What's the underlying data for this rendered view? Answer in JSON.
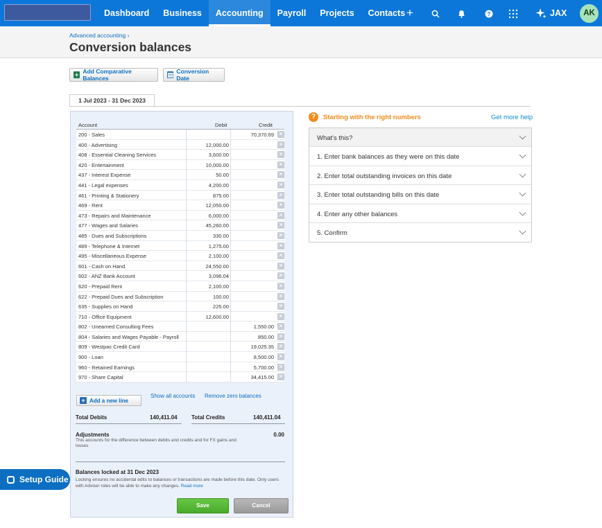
{
  "nav": {
    "items": [
      "Dashboard",
      "Business",
      "Accounting",
      "Payroll",
      "Projects",
      "Contacts"
    ],
    "active": "Accounting",
    "icons": [
      "plus-icon",
      "search-icon",
      "bell-icon",
      "help-icon",
      "apps-grid-icon"
    ],
    "jax_label": "JAX",
    "avatar_initials": "AK"
  },
  "header": {
    "breadcrumb": "Advanced accounting ›",
    "title": "Conversion balances"
  },
  "toolbar": {
    "add_comparative": "Add Comparative Balances",
    "conversion_date": "Conversion Date"
  },
  "period_tab": "1 Jul 2023 - 31 Dec 2023",
  "grid": {
    "headers": {
      "account": "Account",
      "debit": "Debit",
      "credit": "Credit"
    },
    "rows": [
      {
        "account": "200 - Sales",
        "debit": "",
        "credit": "70,370.69"
      },
      {
        "account": "400 - Advertising",
        "debit": "12,000.00",
        "credit": ""
      },
      {
        "account": "408 - Essential Cleaning Services",
        "debit": "3,600.00",
        "credit": ""
      },
      {
        "account": "420 - Entertainment",
        "debit": "10,000.00",
        "credit": ""
      },
      {
        "account": "437 - Interest Expense",
        "debit": "50.00",
        "credit": ""
      },
      {
        "account": "441 - Legal expenses",
        "debit": "4,200.00",
        "credit": ""
      },
      {
        "account": "461 - Printing & Stationery",
        "debit": "875.00",
        "credit": ""
      },
      {
        "account": "469 - Rent",
        "debit": "12,050.00",
        "credit": ""
      },
      {
        "account": "473 - Repairs and Maintenance",
        "debit": "6,000.00",
        "credit": ""
      },
      {
        "account": "477 - Wages and Salaries",
        "debit": "45,260.00",
        "credit": ""
      },
      {
        "account": "485 - Dues and Subscriptions",
        "debit": "330.00",
        "credit": ""
      },
      {
        "account": "489 - Telephone & Internet",
        "debit": "1,275.00",
        "credit": ""
      },
      {
        "account": "495 - Miscellaneous Expense",
        "debit": "2,100.00",
        "credit": ""
      },
      {
        "account": "601 - Cash on Hand",
        "debit": "24,550.00",
        "credit": ""
      },
      {
        "account": "602 - ANZ Bank Account",
        "debit": "3,096.04",
        "credit": ""
      },
      {
        "account": "620 - Prepaid Rent",
        "debit": "2,100.00",
        "credit": ""
      },
      {
        "account": "622 - Prepaid Dues and Subscription",
        "debit": "100.00",
        "credit": ""
      },
      {
        "account": "635 - Supplies on Hand",
        "debit": "225.00",
        "credit": ""
      },
      {
        "account": "710 - Office Equipment",
        "debit": "12,600.00",
        "credit": ""
      },
      {
        "account": "802 - Unearned Consulting Fees",
        "debit": "",
        "credit": "1,550.00"
      },
      {
        "account": "804 - Salaries and Wages Payable - Payroll",
        "debit": "",
        "credit": "850.00"
      },
      {
        "account": "809 - Westpac Credit Card",
        "debit": "",
        "credit": "19,025.35"
      },
      {
        "account": "900 - Loan",
        "debit": "",
        "credit": "8,500.00"
      },
      {
        "account": "960 - Retained Earnings",
        "debit": "",
        "credit": "5,700.00"
      },
      {
        "account": "970 - Share Capital",
        "debit": "",
        "credit": "34,415.00"
      }
    ]
  },
  "actions": {
    "add_line": "Add a new line",
    "show_all": "Show all accounts",
    "remove_zero": "Remove zero balances"
  },
  "totals": {
    "debits_label": "Total Debits",
    "debits_value": "140,411.04",
    "credits_label": "Total Credits",
    "credits_value": "140,411.04"
  },
  "adjustments": {
    "title": "Adjustments",
    "desc": "This accounts for the difference between debits and credits and for FX gains and losses",
    "value": "0.00"
  },
  "lock": {
    "title": "Balances locked at 31 Dec 2023",
    "desc": "Locking ensures no accidental edits to balances or transactions are made before this date. Only users with Adviser roles will be able to make any changes.",
    "read_more": "Read more"
  },
  "buttons": {
    "save": "Save",
    "cancel": "Cancel"
  },
  "help": {
    "title": "Starting with the right numbers",
    "link": "Get more help",
    "items": [
      "What's this?",
      "1. Enter bank balances as they were on this date",
      "2. Enter total outstanding invoices on this date",
      "3. Enter total outstanding bills on this date",
      "4. Enter any other balances",
      "5. Confirm"
    ]
  },
  "setup_guide": "Setup Guide"
}
